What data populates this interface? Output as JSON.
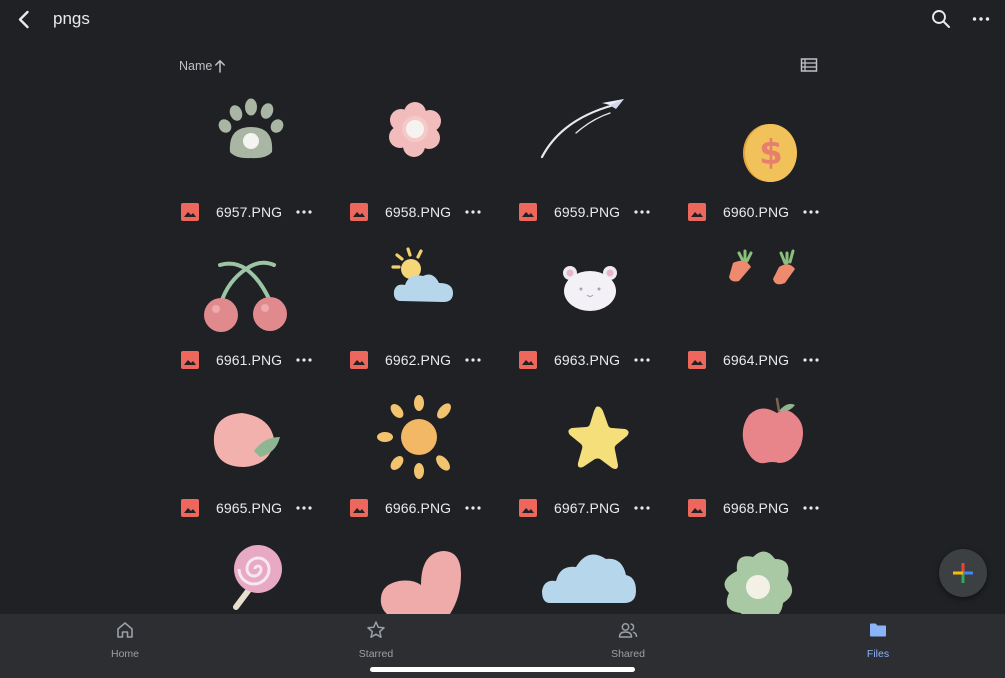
{
  "header": {
    "title": "pngs",
    "back_icon": "chevron-left-icon",
    "search_icon": "search-icon",
    "more_icon": "more-horizontal-icon"
  },
  "sort": {
    "label": "Name",
    "direction_icon": "arrow-up-icon"
  },
  "view_toggle_icon": "list-view-icon",
  "files": [
    {
      "name": "6957.PNG",
      "thumbnail": "paw-icon"
    },
    {
      "name": "6958.PNG",
      "thumbnail": "flower-icon"
    },
    {
      "name": "6959.PNG",
      "thumbnail": "paper-plane-icon"
    },
    {
      "name": "6960.PNG",
      "thumbnail": "dollar-coin-icon"
    },
    {
      "name": "6961.PNG",
      "thumbnail": "cherries-icon"
    },
    {
      "name": "6962.PNG",
      "thumbnail": "sun-cloud-icon"
    },
    {
      "name": "6963.PNG",
      "thumbnail": "bear-face-icon"
    },
    {
      "name": "6964.PNG",
      "thumbnail": "carrots-icon"
    },
    {
      "name": "6965.PNG",
      "thumbnail": "peach-icon"
    },
    {
      "name": "6966.PNG",
      "thumbnail": "sun-icon"
    },
    {
      "name": "6967.PNG",
      "thumbnail": "star-icon"
    },
    {
      "name": "6968.PNG",
      "thumbnail": "apple-icon"
    },
    {
      "name": "",
      "thumbnail": "lollipop-icon"
    },
    {
      "name": "",
      "thumbnail": "heart-icon"
    },
    {
      "name": "",
      "thumbnail": "cloud-icon"
    },
    {
      "name": "",
      "thumbnail": "flower-green-icon"
    }
  ],
  "fab_icon": "plus-icon",
  "nav": {
    "home": "Home",
    "starred": "Starred",
    "shared": "Shared",
    "files": "Files",
    "active": "files"
  },
  "colors": {
    "background": "#202124",
    "bottom_nav": "#2d2e31",
    "accent": "#8ab4f8",
    "image_file_icon": "#ee675c"
  }
}
